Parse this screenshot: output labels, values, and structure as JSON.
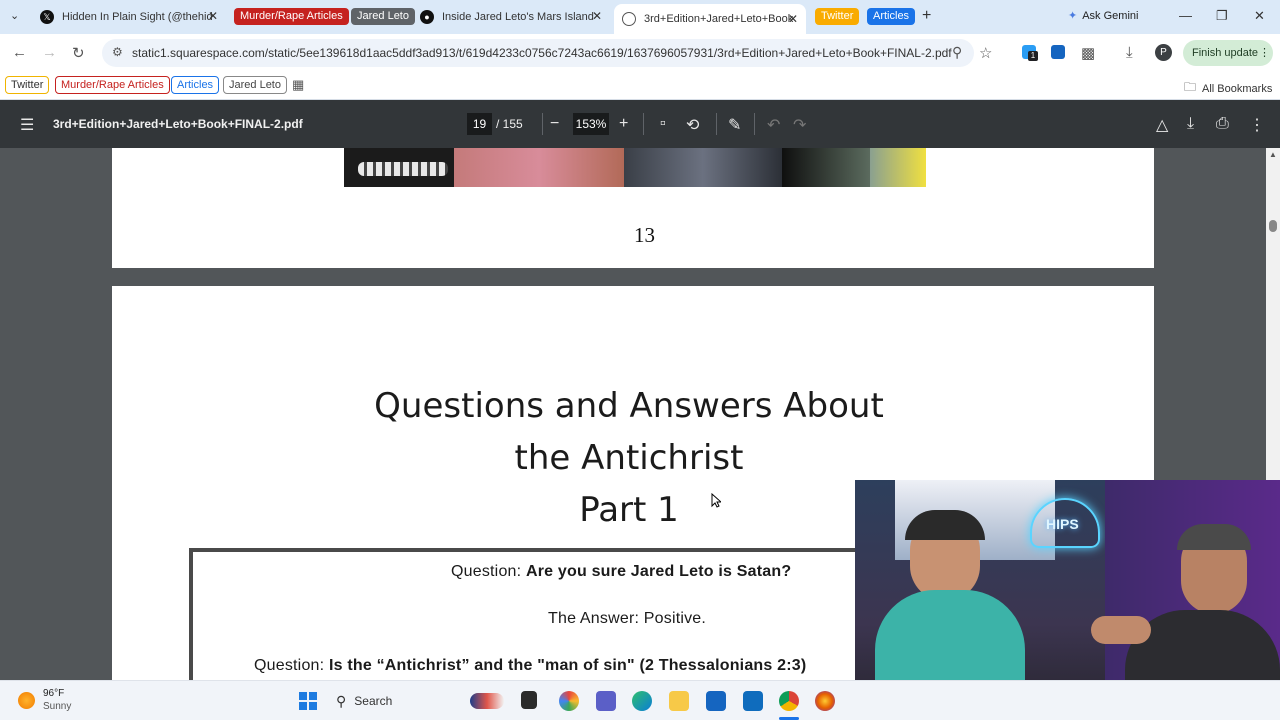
{
  "tabs": [
    {
      "label": "Hidden In Plain Sight (@thehid",
      "icon": "x-logo-icon"
    },
    {
      "label": "Inside Jared Leto's Mars Island",
      "icon": "site-favicon-icon"
    },
    {
      "label": "3rd+Edition+Jared+Leto+Book",
      "icon": "globe-icon"
    }
  ],
  "tab_groups": [
    "Murder/Rape Articles",
    "Jared Leto",
    "Twitter",
    "Articles"
  ],
  "ask_gemini": "Ask Gemini",
  "url": "static1.squarespace.com/static/5ee139618d1aac5ddf3ad913/t/619d4233c0756c7243ac6619/1637696057931/3rd+Edition+Jared+Leto+Book+FINAL-2.pdf",
  "finish_update": "Finish update",
  "profile_initial": "P",
  "extension_badge": "1",
  "bookmarks": [
    "Twitter",
    "Murder/Rape Articles",
    "Articles",
    "Jared Leto"
  ],
  "all_bookmarks": "All Bookmarks",
  "pdf": {
    "filename": "3rd+Edition+Jared+Leto+Book+FINAL-2.pdf",
    "page_current": "19",
    "page_total": "/ 155",
    "zoom": "153%",
    "prev_page_number": "13",
    "title_line1": "Questions and Answers About",
    "title_line2": "the Antichrist",
    "title_line3": "Part 1",
    "q1_label": "Question:",
    "q1_text": "Are you sure Jared Leto is Satan?",
    "a1": "The Answer: Positive.",
    "q2_label": "Question:",
    "q2_text": "Is the “Antichrist” and the \"man of sin\" (2 Thessalonians 2:3)"
  },
  "webcam": {
    "sign_text": "HIPS"
  },
  "taskbar": {
    "temperature": "96°F",
    "weather": "Sunny",
    "search": "Search"
  },
  "colors": {
    "tab_strip": "#dbe9f8",
    "group_red": "#c5221f",
    "group_grey": "#5f6368",
    "group_yellow": "#f9ab00",
    "group_blue": "#1a73e8",
    "pdf_toolbar": "#323639",
    "pdf_background": "#525659"
  }
}
